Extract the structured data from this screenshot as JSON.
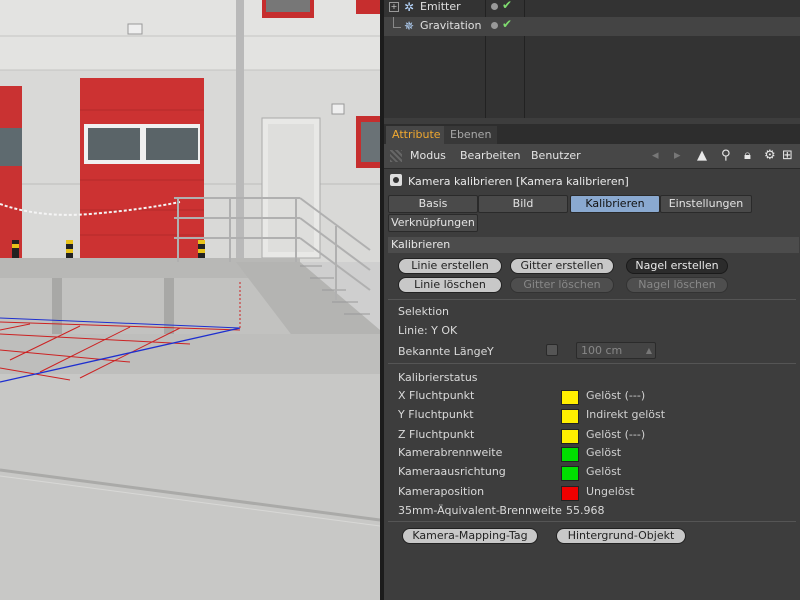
{
  "object_manager": {
    "rows": [
      {
        "name": "Emitter",
        "icon": "emitter-icon"
      },
      {
        "name": "Gravitation",
        "icon": "gravitation-icon"
      }
    ]
  },
  "tabs": [
    "Attribute",
    "Ebenen"
  ],
  "menu": [
    "Modus",
    "Bearbeiten",
    "Benutzer"
  ],
  "object_title": "Kamera kalibrieren [Kamera kalibrieren]",
  "subtabs": [
    "Basis",
    "Bild",
    "Kalibrieren",
    "Einstellungen",
    "Verknüpfungen"
  ],
  "active_subtab": "Kalibrieren",
  "section_title": "Kalibrieren",
  "buttons": {
    "line_create": "Linie erstellen",
    "grid_create": "Gitter erstellen",
    "nail_create": "Nagel erstellen",
    "line_delete": "Linie löschen",
    "grid_delete": "Gitter löschen",
    "nail_delete": "Nagel löschen"
  },
  "selection": {
    "title": "Selektion",
    "line_status": "Linie: Y OK",
    "known_length_label": "Bekannte Länge",
    "known_length_axis": "Y",
    "known_length_value": "100 cm"
  },
  "calibration_status": {
    "title": "Kalibrierstatus",
    "items": [
      {
        "label": "X Fluchtpunkt",
        "color": "#ffee00",
        "status": "Gelöst (---)"
      },
      {
        "label": "Y Fluchtpunkt",
        "color": "#ffee00",
        "status": "Indirekt gelöst"
      },
      {
        "label": "Z Fluchtpunkt",
        "color": "#ffee00",
        "status": "Gelöst (---)"
      },
      {
        "label": "Kamerabrennweite",
        "color": "#00e000",
        "status": "Gelöst"
      },
      {
        "label": "Kameraausrichtung",
        "color": "#00e000",
        "status": "Gelöst"
      },
      {
        "label": "Kameraposition",
        "color": "#ee0000",
        "status": "Ungelöst"
      }
    ],
    "focal_label": "35mm-Äquivalent-Brennweite",
    "focal_value": "55.968"
  },
  "bottom_buttons": [
    "Kamera-Mapping-Tag",
    "Hintergrund-Objekt"
  ],
  "colors": {
    "accent_tab": "#f0a830",
    "active_subtab": "#8aa9d0"
  }
}
